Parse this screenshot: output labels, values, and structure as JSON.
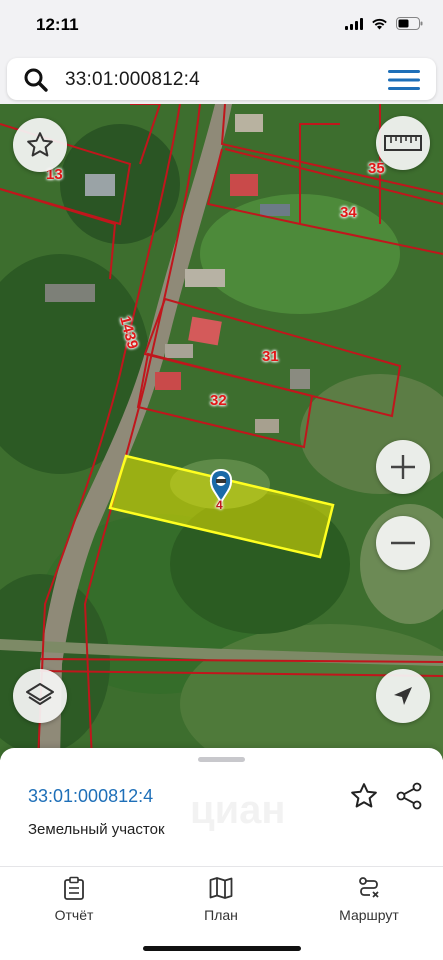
{
  "status_bar": {
    "time": "12:11"
  },
  "search": {
    "query": "33:01:000812:4"
  },
  "map": {
    "parcel_labels": [
      "13",
      "35",
      "34",
      "1439",
      "31",
      "32",
      "4"
    ],
    "selected_parcel_color": "#e8e600",
    "boundary_color": "#c0161c"
  },
  "sheet": {
    "title": "33:01:000812:4",
    "subtitle": "Земельный участок",
    "watermark": "циан"
  },
  "tabs": [
    {
      "label": "Отчёт",
      "icon": "clipboard-icon"
    },
    {
      "label": "План",
      "icon": "map-icon"
    },
    {
      "label": "Маршрут",
      "icon": "route-icon"
    }
  ],
  "colors": {
    "accent": "#1e6fb8",
    "sheet_bg": "#ffffff"
  }
}
